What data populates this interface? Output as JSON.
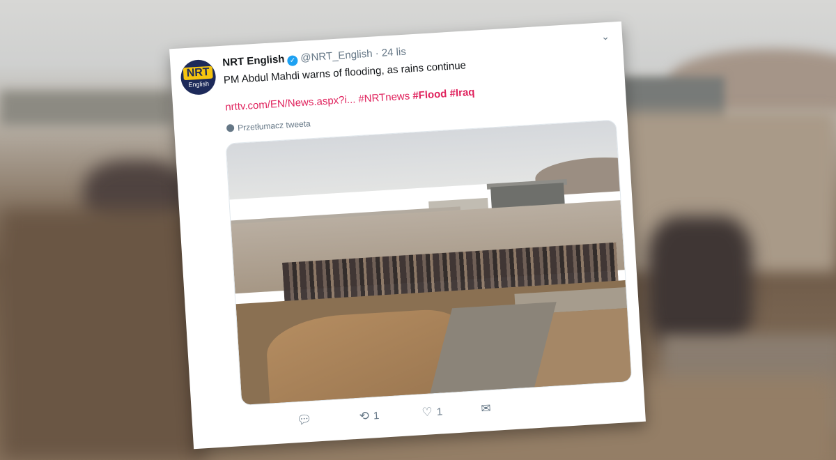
{
  "tweet": {
    "display_name": "NRT English",
    "handle": "@NRT_English",
    "separator": "·",
    "time": "24 lis",
    "avatar": {
      "logo": "NRT",
      "sub": "English"
    },
    "text": "PM Abdul Mahdi warns of flooding, as rains continue",
    "link": "nrttv.com/EN/News.aspx?i...",
    "hashtags": [
      "#NRTnews",
      "#Flood",
      "#Iraq"
    ],
    "translate_label": "Przetłumacz tweeta",
    "counts": {
      "retweets": "1",
      "likes": "1"
    },
    "icons": {
      "more": "chevron-down-icon",
      "verified": "verified-badge-icon",
      "translate": "globe-icon",
      "reply": "reply-icon",
      "retweet": "retweet-icon",
      "like": "heart-icon",
      "dm": "envelope-icon"
    }
  },
  "colors": {
    "link": "#e0245e",
    "verified": "#1da1f2",
    "muted": "#657786"
  }
}
